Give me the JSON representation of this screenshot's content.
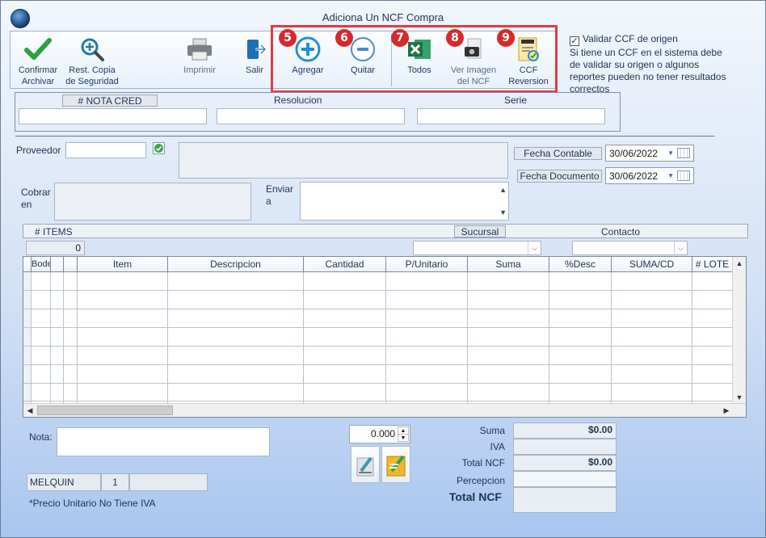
{
  "window": {
    "title": "Adiciona Un NCF Compra"
  },
  "toolbar": {
    "confirm": "Confirmar Archivar",
    "restore": "Rest. Copia de Seguridad",
    "print": "Imprimir",
    "exit": "Salir",
    "add": "Agregar",
    "remove": "Quitar",
    "all": "Todos",
    "view_image": "Ver Imagen del NCF",
    "ccf_reversion": "CCF Reversion"
  },
  "badges": [
    "5",
    "6",
    "7",
    "8",
    "9"
  ],
  "side_info": {
    "checkbox_label": "Validar CCF de origen",
    "checked": true,
    "note": "Si tiene un CCF en el sistema debe de validar su origen o algunos reportes pueden no tener resultados correctos"
  },
  "ncf": {
    "nota_cred_label": "# NOTA CRED",
    "resolucion_label": "Resolucion",
    "serie_label": "Serie"
  },
  "form": {
    "proveedor_label": "Proveedor",
    "cobrar_label": "Cobrar en",
    "enviar_label": "Enviar a",
    "fecha_contable_label": "Fecha Contable",
    "fecha_contable_value": "30/06/2022",
    "fecha_documento_label": "Fecha Documento",
    "fecha_documento_value": "30/06/2022"
  },
  "items_bar": {
    "items_label": "# ITEMS",
    "items_count": "0",
    "sucursal_label": "Sucursal",
    "contacto_label": "Contacto"
  },
  "grid": {
    "columns": [
      "Bodega",
      "Item",
      "Descripcion",
      "Cantidad",
      "P/Unitario",
      "Suma",
      "%Desc",
      "SUMA/CD",
      "# LOTE"
    ]
  },
  "footer": {
    "nota_label": "Nota:",
    "qty_value": "0.000",
    "user": "MELQUIN",
    "user_num": "1",
    "note": "*Precio Unitario No Tiene IVA"
  },
  "totals": {
    "suma_label": "Suma",
    "suma_value": "$0.00",
    "iva_label": "IVA",
    "total_ncf_label": "Total NCF",
    "total_ncf_value": "$0.00",
    "percepcion_label": "Percepcion",
    "grand_total_label": "Total NCF"
  }
}
